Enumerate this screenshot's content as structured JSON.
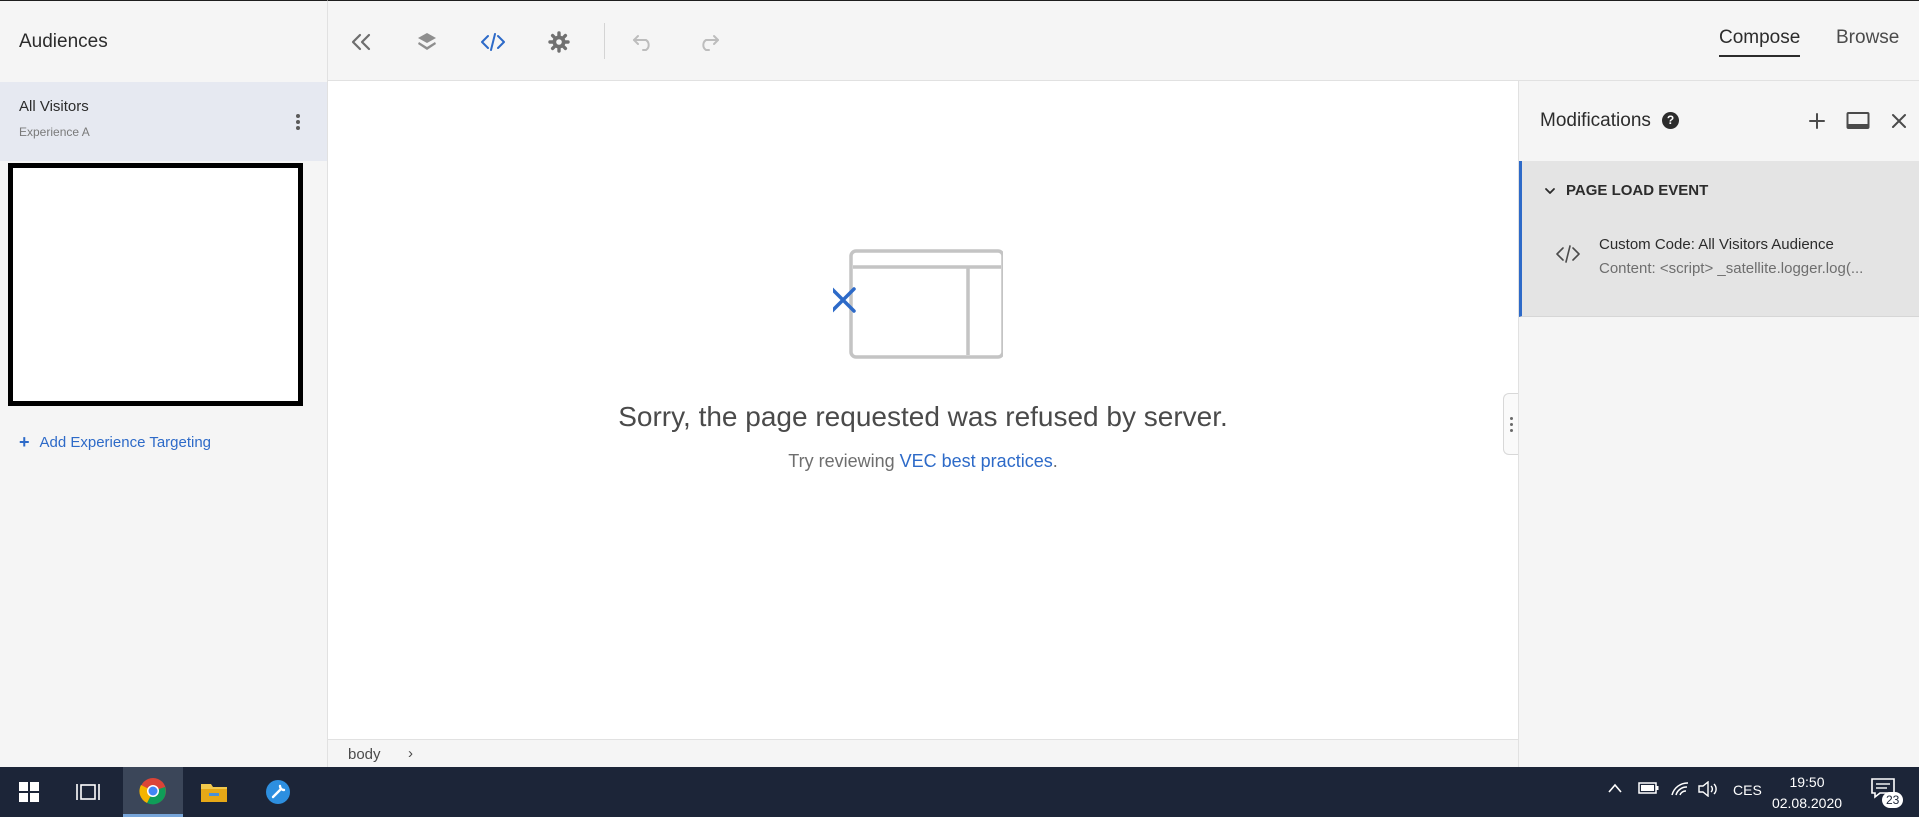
{
  "left_panel": {
    "title": "Audiences",
    "audience": {
      "name": "All Visitors",
      "experience": "Experience A"
    },
    "add_targeting_label": "Add Experience Targeting"
  },
  "toolbar": {
    "icons": [
      "collapse-left-icon",
      "layers-icon",
      "code-icon",
      "settings-icon",
      "undo-icon",
      "redo-icon"
    ],
    "modes": {
      "compose": "Compose",
      "browse": "Browse"
    },
    "active_mode": "Compose"
  },
  "canvas": {
    "error_message": "Sorry, the page requested was refused by server.",
    "hint_prefix": "Try reviewing ",
    "hint_link": "VEC best practices",
    "hint_suffix": "."
  },
  "path_bar": {
    "element": "body",
    "chevron": "›"
  },
  "modifications": {
    "title": "Modifications",
    "help_glyph": "?",
    "event_header": "PAGE LOAD EVENT",
    "item_title": "Custom Code: All Visitors Audience",
    "item_content": "Content: <script> _satellite.logger.log(..."
  },
  "taskbar": {
    "language": "CES",
    "time": "19:50",
    "date": "02.08.2020",
    "notifications": "23"
  },
  "colors": {
    "accent": "#2d6ac8",
    "taskbar": "#1c2538",
    "panel": "#f5f5f5"
  }
}
